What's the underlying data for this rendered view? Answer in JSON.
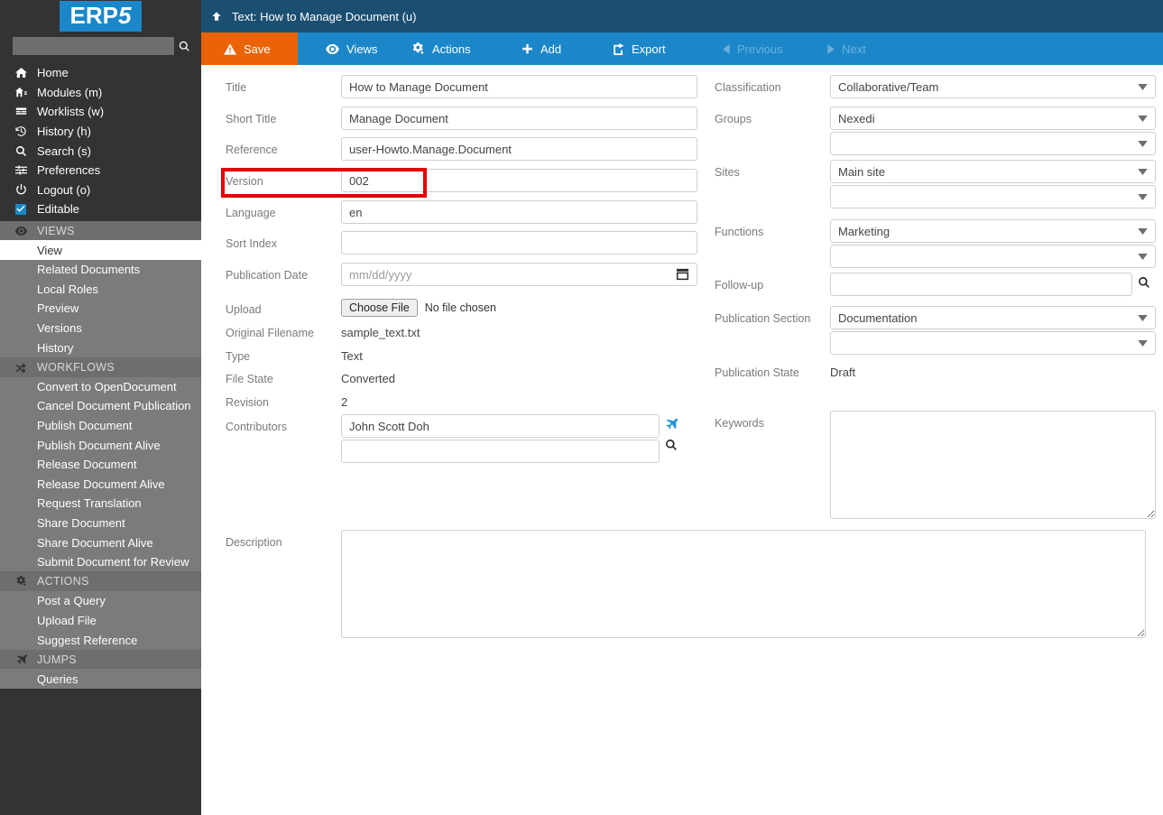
{
  "brand": {
    "logo_text": "ERP",
    "logo_suffix": "5"
  },
  "colors": {
    "brand_blue": "#1b87c9",
    "header_navy": "#1b4f72",
    "save_orange": "#ea6307",
    "sidebar_dark": "#333333",
    "sidebar_menu_gray": "#7b7b7b",
    "annotation_red": "#e60000"
  },
  "sidebar": {
    "search": {
      "value": "",
      "placeholder": ""
    },
    "nav": [
      {
        "label": "Home",
        "icon": "home-icon"
      },
      {
        "label": "Modules (m)",
        "icon": "modules-icon"
      },
      {
        "label": "Worklists (w)",
        "icon": "worklists-icon"
      },
      {
        "label": "History (h)",
        "icon": "history-icon"
      },
      {
        "label": "Search (s)",
        "icon": "search-icon"
      },
      {
        "label": "Preferences",
        "icon": "preferences-icon"
      },
      {
        "label": "Logout (o)",
        "icon": "power-icon"
      },
      {
        "label": "Editable",
        "icon": "checkbox-checked-icon"
      }
    ],
    "sections": [
      {
        "title": "VIEWS",
        "icon": "eye-icon",
        "items": [
          {
            "label": "View",
            "active": true
          },
          {
            "label": "Related Documents",
            "active": false
          },
          {
            "label": "Local Roles",
            "active": false
          },
          {
            "label": "Preview",
            "active": false
          },
          {
            "label": "Versions",
            "active": false
          },
          {
            "label": "History",
            "active": false
          }
        ]
      },
      {
        "title": "WORKFLOWS",
        "icon": "shuffle-icon",
        "items": [
          {
            "label": "Convert to OpenDocument",
            "active": false
          },
          {
            "label": "Cancel Document Publication",
            "active": false
          },
          {
            "label": "Publish Document",
            "active": false
          },
          {
            "label": "Publish Document Alive",
            "active": false
          },
          {
            "label": "Release Document",
            "active": false
          },
          {
            "label": "Release Document Alive",
            "active": false
          },
          {
            "label": "Request Translation",
            "active": false
          },
          {
            "label": "Share Document",
            "active": false
          },
          {
            "label": "Share Document Alive",
            "active": false
          },
          {
            "label": "Submit Document for Review",
            "active": false
          }
        ]
      },
      {
        "title": "ACTIONS",
        "icon": "gear-icon",
        "items": [
          {
            "label": "Post a Query",
            "active": false
          },
          {
            "label": "Upload File",
            "active": false
          },
          {
            "label": "Suggest Reference",
            "active": false
          }
        ]
      },
      {
        "title": "JUMPS",
        "icon": "plane-icon",
        "items": [
          {
            "label": "Queries",
            "active": false
          }
        ]
      }
    ]
  },
  "header": {
    "title": "Text: How to Manage Document (u)",
    "up_icon": "arrow-up-icon"
  },
  "toolbar": {
    "save": {
      "label": "Save",
      "icon": "warning-triangle-icon",
      "disabled": false
    },
    "views": {
      "label": "Views",
      "icon": "eye-icon",
      "disabled": false
    },
    "actions": {
      "label": "Actions",
      "icon": "gear-icon",
      "disabled": false
    },
    "add": {
      "label": "Add",
      "icon": "plus-icon",
      "disabled": false
    },
    "export": {
      "label": "Export",
      "icon": "export-icon",
      "disabled": false
    },
    "previous": {
      "label": "Previous",
      "icon": "caret-left-icon",
      "disabled": true
    },
    "next": {
      "label": "Next",
      "icon": "caret-right-icon",
      "disabled": true
    }
  },
  "form": {
    "left": {
      "title": {
        "label": "Title",
        "value": "How to Manage Document"
      },
      "short_title": {
        "label": "Short Title",
        "value": "Manage Document"
      },
      "reference": {
        "label": "Reference",
        "value": "user-Howto.Manage.Document"
      },
      "version": {
        "label": "Version",
        "value": "002"
      },
      "language": {
        "label": "Language",
        "value": "en"
      },
      "sort_index": {
        "label": "Sort Index",
        "value": ""
      },
      "publication_date": {
        "label": "Publication Date",
        "value": "",
        "placeholder": "mm/dd/yyyy"
      },
      "upload": {
        "label": "Upload",
        "button_label": "Choose File",
        "file_status": "No file chosen"
      },
      "original_filename": {
        "label": "Original Filename",
        "value": "sample_text.txt"
      },
      "type": {
        "label": "Type",
        "value": "Text"
      },
      "file_state": {
        "label": "File State",
        "value": "Converted"
      },
      "revision": {
        "label": "Revision",
        "value": "2"
      },
      "contributors": {
        "label": "Contributors",
        "value": "John Scott Doh",
        "second_value": "",
        "jump_icon": "plane-icon",
        "search_icon": "search-icon"
      },
      "description": {
        "label": "Description",
        "value": ""
      }
    },
    "right": {
      "classification": {
        "label": "Classification",
        "value": "Collaborative/Team"
      },
      "groups": {
        "label": "Groups",
        "value": "Nexedi",
        "second_value": ""
      },
      "sites": {
        "label": "Sites",
        "value": "Main site",
        "second_value": ""
      },
      "functions": {
        "label": "Functions",
        "value": "Marketing",
        "second_value": ""
      },
      "follow_up": {
        "label": "Follow-up",
        "value": "",
        "search_icon": "search-icon"
      },
      "publication_section": {
        "label": "Publication Section",
        "value": "Documentation",
        "second_value": ""
      },
      "publication_state": {
        "label": "Publication State",
        "value": "Draft"
      },
      "keywords": {
        "label": "Keywords",
        "value": ""
      }
    }
  },
  "annotation": {
    "target": "version-field",
    "shape": "rectangle",
    "color": "#e60000"
  }
}
